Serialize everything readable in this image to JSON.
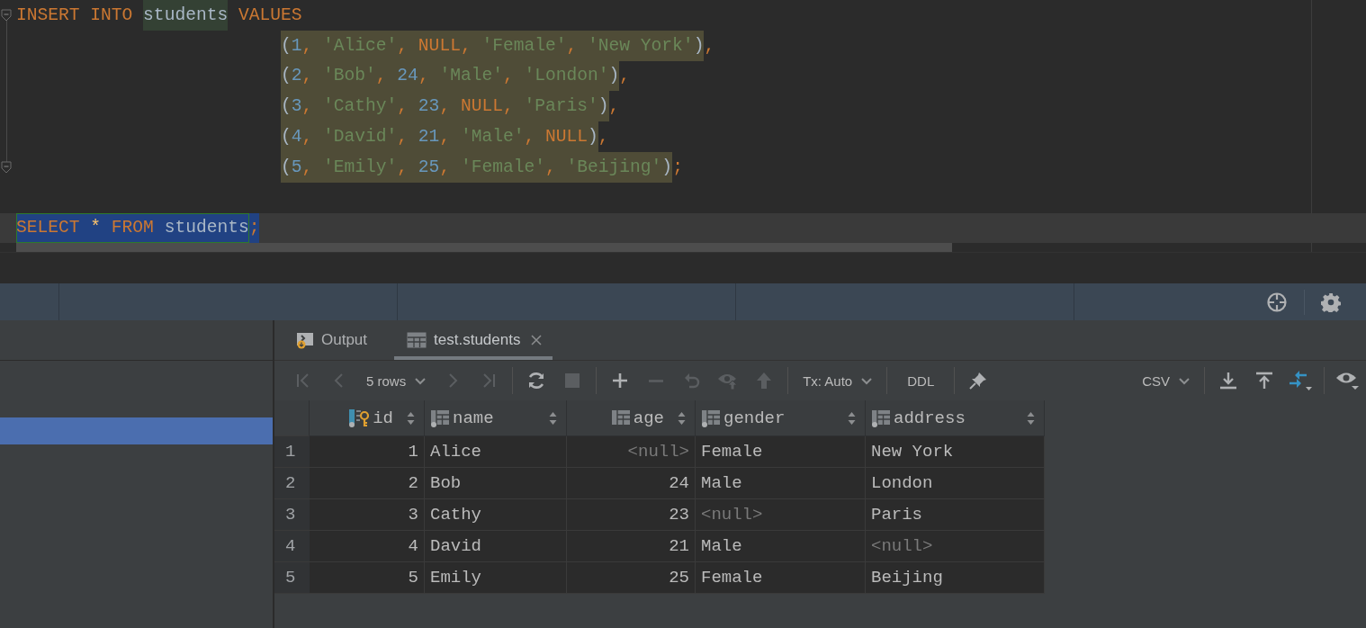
{
  "editor": {
    "lines": [
      {
        "indented": false,
        "current": false,
        "fold": true,
        "groups": [
          {
            "kind": "none",
            "tokens": [
              {
                "text": "INSERT INTO ",
                "kind": "keyword"
              }
            ]
          },
          {
            "kind": "reference",
            "tokens": [
              {
                "text": "students",
                "kind": "ident"
              }
            ]
          },
          {
            "kind": "none",
            "tokens": [
              {
                "text": " VALUES",
                "kind": "keyword"
              }
            ]
          }
        ]
      },
      {
        "indented": true,
        "current": false,
        "fold": false,
        "groups": [
          {
            "kind": "usage",
            "tokens": [
              {
                "text": "(",
                "kind": "paren"
              },
              {
                "text": "1",
                "kind": "number"
              },
              {
                "text": ", ",
                "kind": "punct"
              },
              {
                "text": "'Alice'",
                "kind": "string"
              },
              {
                "text": ", ",
                "kind": "punct"
              },
              {
                "text": "NULL",
                "kind": "keyword"
              },
              {
                "text": ", ",
                "kind": "punct"
              },
              {
                "text": "'Female'",
                "kind": "string"
              },
              {
                "text": ", ",
                "kind": "punct"
              },
              {
                "text": "'New York'",
                "kind": "string"
              },
              {
                "text": ")",
                "kind": "paren"
              }
            ]
          },
          {
            "kind": "none",
            "tokens": [
              {
                "text": ",",
                "kind": "punct"
              }
            ]
          }
        ]
      },
      {
        "indented": true,
        "current": false,
        "fold": false,
        "groups": [
          {
            "kind": "usage",
            "tokens": [
              {
                "text": "(",
                "kind": "paren"
              },
              {
                "text": "2",
                "kind": "number"
              },
              {
                "text": ", ",
                "kind": "punct"
              },
              {
                "text": "'Bob'",
                "kind": "string"
              },
              {
                "text": ", ",
                "kind": "punct"
              },
              {
                "text": "24",
                "kind": "number"
              },
              {
                "text": ", ",
                "kind": "punct"
              },
              {
                "text": "'Male'",
                "kind": "string"
              },
              {
                "text": ", ",
                "kind": "punct"
              },
              {
                "text": "'London'",
                "kind": "string"
              },
              {
                "text": ")",
                "kind": "paren"
              }
            ]
          },
          {
            "kind": "none",
            "tokens": [
              {
                "text": ",",
                "kind": "punct"
              }
            ]
          }
        ]
      },
      {
        "indented": true,
        "current": false,
        "fold": false,
        "groups": [
          {
            "kind": "usage",
            "tokens": [
              {
                "text": "(",
                "kind": "paren"
              },
              {
                "text": "3",
                "kind": "number"
              },
              {
                "text": ", ",
                "kind": "punct"
              },
              {
                "text": "'Cathy'",
                "kind": "string"
              },
              {
                "text": ", ",
                "kind": "punct"
              },
              {
                "text": "23",
                "kind": "number"
              },
              {
                "text": ", ",
                "kind": "punct"
              },
              {
                "text": "NULL",
                "kind": "keyword"
              },
              {
                "text": ", ",
                "kind": "punct"
              },
              {
                "text": "'Paris'",
                "kind": "string"
              },
              {
                "text": ")",
                "kind": "paren"
              }
            ]
          },
          {
            "kind": "none",
            "tokens": [
              {
                "text": ",",
                "kind": "punct"
              }
            ]
          }
        ]
      },
      {
        "indented": true,
        "current": false,
        "fold": false,
        "groups": [
          {
            "kind": "usage",
            "tokens": [
              {
                "text": "(",
                "kind": "paren"
              },
              {
                "text": "4",
                "kind": "number"
              },
              {
                "text": ", ",
                "kind": "punct"
              },
              {
                "text": "'David'",
                "kind": "string"
              },
              {
                "text": ", ",
                "kind": "punct"
              },
              {
                "text": "21",
                "kind": "number"
              },
              {
                "text": ", ",
                "kind": "punct"
              },
              {
                "text": "'Male'",
                "kind": "string"
              },
              {
                "text": ", ",
                "kind": "punct"
              },
              {
                "text": "NULL",
                "kind": "keyword"
              },
              {
                "text": ")",
                "kind": "paren"
              }
            ]
          },
          {
            "kind": "none",
            "tokens": [
              {
                "text": ",",
                "kind": "punct"
              }
            ]
          }
        ]
      },
      {
        "indented": true,
        "current": false,
        "fold": true,
        "groups": [
          {
            "kind": "usage",
            "tokens": [
              {
                "text": "(",
                "kind": "paren"
              },
              {
                "text": "5",
                "kind": "number"
              },
              {
                "text": ", ",
                "kind": "punct"
              },
              {
                "text": "'Emily'",
                "kind": "string"
              },
              {
                "text": ", ",
                "kind": "punct"
              },
              {
                "text": "25",
                "kind": "number"
              },
              {
                "text": ", ",
                "kind": "punct"
              },
              {
                "text": "'Female'",
                "kind": "string"
              },
              {
                "text": ", ",
                "kind": "punct"
              },
              {
                "text": "'Beijing'",
                "kind": "string"
              },
              {
                "text": ")",
                "kind": "paren"
              }
            ]
          },
          {
            "kind": "none",
            "tokens": [
              {
                "text": ";",
                "kind": "punct"
              }
            ]
          }
        ]
      },
      {
        "current": false
      },
      {
        "indented": false,
        "current": true,
        "fold": false,
        "groups": [
          {
            "kind": "statement",
            "tokens": [
              {
                "text": "SELECT ",
                "kind": "keyword"
              },
              {
                "text": "*",
                "kind": "star"
              },
              {
                "text": " FROM ",
                "kind": "keyword"
              },
              {
                "text": "students",
                "kind": "ident"
              }
            ]
          },
          {
            "kind": "selection",
            "tokens": [
              {
                "text": ";",
                "kind": "punct"
              }
            ]
          }
        ]
      }
    ]
  },
  "sidebar": {
    "rows": [
      {
        "selected": true
      }
    ]
  },
  "results": {
    "tabs": [
      {
        "label": "Output",
        "kind": "output",
        "selected": false,
        "closable": false
      },
      {
        "label": "test.students",
        "kind": "table",
        "selected": true,
        "closable": true
      }
    ],
    "toolbar": {
      "rows_dropdown": "5 rows",
      "tx_dropdown": "Tx: Auto",
      "ddl": "DDL",
      "format_dropdown": "CSV",
      "buttons": {
        "first_page": {
          "disabled": true
        },
        "previous_page": {
          "disabled": true
        },
        "next_page": {
          "disabled": true
        },
        "last_page": {
          "disabled": true
        },
        "stop": {
          "disabled": true
        },
        "add_row": {
          "disabled": false
        },
        "delete_row": {
          "disabled": true
        },
        "revert": {
          "disabled": true
        },
        "preview": {
          "disabled": true
        },
        "submit": {
          "disabled": true
        }
      }
    },
    "table": {
      "columns": [
        {
          "name": "id",
          "numeric": true,
          "primary_key": true
        },
        {
          "name": "name",
          "numeric": false,
          "primary_key": false
        },
        {
          "name": "age",
          "numeric": true,
          "primary_key": false
        },
        {
          "name": "gender",
          "numeric": false,
          "primary_key": false
        },
        {
          "name": "address",
          "numeric": false,
          "primary_key": false
        }
      ],
      "rows": [
        {
          "number": "1",
          "cells": [
            {
              "text": "1",
              "is_null": false
            },
            {
              "text": "Alice",
              "is_null": false
            },
            {
              "text": "<null>",
              "is_null": true
            },
            {
              "text": "Female",
              "is_null": false
            },
            {
              "text": "New York",
              "is_null": false
            }
          ]
        },
        {
          "number": "2",
          "cells": [
            {
              "text": "2",
              "is_null": false
            },
            {
              "text": "Bob",
              "is_null": false
            },
            {
              "text": "24",
              "is_null": false
            },
            {
              "text": "Male",
              "is_null": false
            },
            {
              "text": "London",
              "is_null": false
            }
          ]
        },
        {
          "number": "3",
          "cells": [
            {
              "text": "3",
              "is_null": false
            },
            {
              "text": "Cathy",
              "is_null": false
            },
            {
              "text": "23",
              "is_null": false
            },
            {
              "text": "<null>",
              "is_null": true
            },
            {
              "text": "Paris",
              "is_null": false
            }
          ]
        },
        {
          "number": "4",
          "cells": [
            {
              "text": "4",
              "is_null": false
            },
            {
              "text": "David",
              "is_null": false
            },
            {
              "text": "21",
              "is_null": false
            },
            {
              "text": "Male",
              "is_null": false
            },
            {
              "text": "<null>",
              "is_null": true
            }
          ]
        },
        {
          "number": "5",
          "cells": [
            {
              "text": "5",
              "is_null": false
            },
            {
              "text": "Emily",
              "is_null": false
            },
            {
              "text": "25",
              "is_null": false
            },
            {
              "text": "Female",
              "is_null": false
            },
            {
              "text": "Beijing",
              "is_null": false
            }
          ]
        }
      ]
    }
  }
}
